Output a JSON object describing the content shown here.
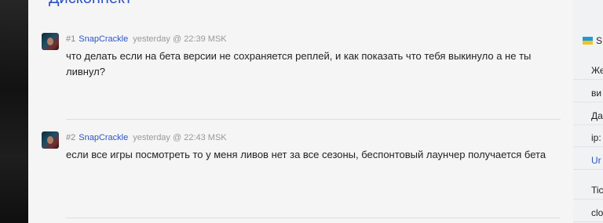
{
  "thread": {
    "title": "Дисконнект"
  },
  "posts": [
    {
      "number": "#1",
      "author": "SnapCrackle",
      "time": "yesterday @ 22:39 MSK",
      "text": "что делать если на бета версии не сохраняется реплей, и как показать что тебя выкинуло а не ты ливнул?"
    },
    {
      "number": "#2",
      "author": "SnapCrackle",
      "time": "yesterday @ 22:43 MSK",
      "text": "если все игры посмотреть то у меня ливов нет за все сезоны, беспонтовый лаунчер получается бета"
    }
  ],
  "sidebar": {
    "header": "S",
    "rows": [
      "Же",
      "ви",
      "Да",
      "ip:",
      "Ur",
      "Tic",
      "clo"
    ]
  },
  "colors": {
    "accent": "#2d56c4",
    "page_bg": "#f5f5f5",
    "dark_bg": "#1b1b1b"
  }
}
